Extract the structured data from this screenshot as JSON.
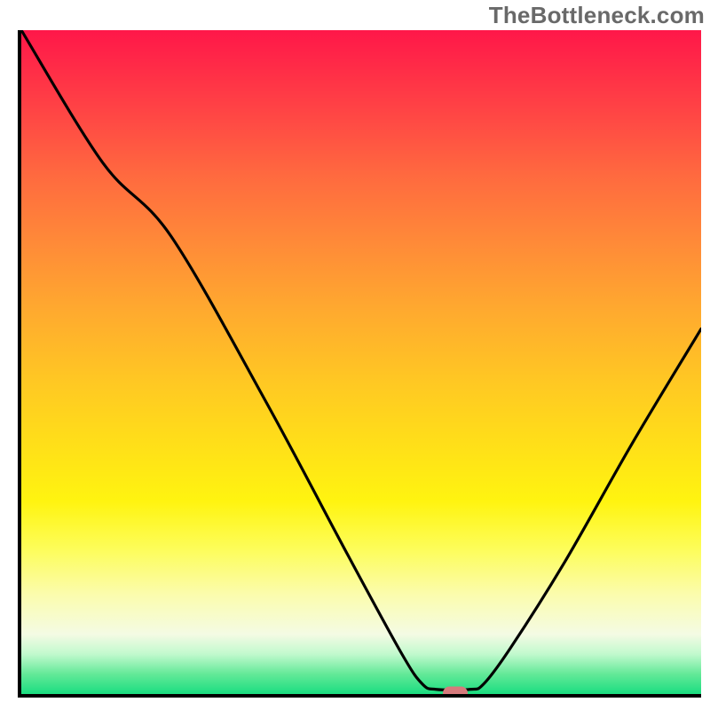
{
  "watermark_text": "TheBottleneck.com",
  "plot": {
    "x_range": [
      0,
      100
    ],
    "y_range": [
      0,
      100
    ]
  },
  "chart_data": {
    "type": "line",
    "title": "",
    "xlabel": "",
    "ylabel": "",
    "xlim": [
      0,
      100
    ],
    "ylim": [
      0,
      100
    ],
    "grid": false,
    "curve_points": [
      {
        "x": 0.0,
        "y": 100.0
      },
      {
        "x": 12.0,
        "y": 80.0
      },
      {
        "x": 22.0,
        "y": 69.0
      },
      {
        "x": 36.0,
        "y": 44.0
      },
      {
        "x": 48.0,
        "y": 21.0
      },
      {
        "x": 56.0,
        "y": 6.0
      },
      {
        "x": 59.0,
        "y": 1.5
      },
      {
        "x": 61.0,
        "y": 0.7
      },
      {
        "x": 66.0,
        "y": 0.7
      },
      {
        "x": 68.0,
        "y": 1.5
      },
      {
        "x": 72.0,
        "y": 7.0
      },
      {
        "x": 80.0,
        "y": 20.0
      },
      {
        "x": 90.0,
        "y": 38.0
      },
      {
        "x": 100.0,
        "y": 55.0
      }
    ],
    "minimum_marker": {
      "x": 63.5,
      "y": 0.7,
      "color": "#d67a7c"
    },
    "background_gradient": {
      "stops": [
        {
          "pos": 0.0,
          "color": "#ff1749"
        },
        {
          "pos": 0.5,
          "color": "#ffc823"
        },
        {
          "pos": 0.78,
          "color": "#fdfd58"
        },
        {
          "pos": 0.95,
          "color": "#63e998"
        },
        {
          "pos": 1.0,
          "color": "#1add80"
        }
      ]
    }
  }
}
